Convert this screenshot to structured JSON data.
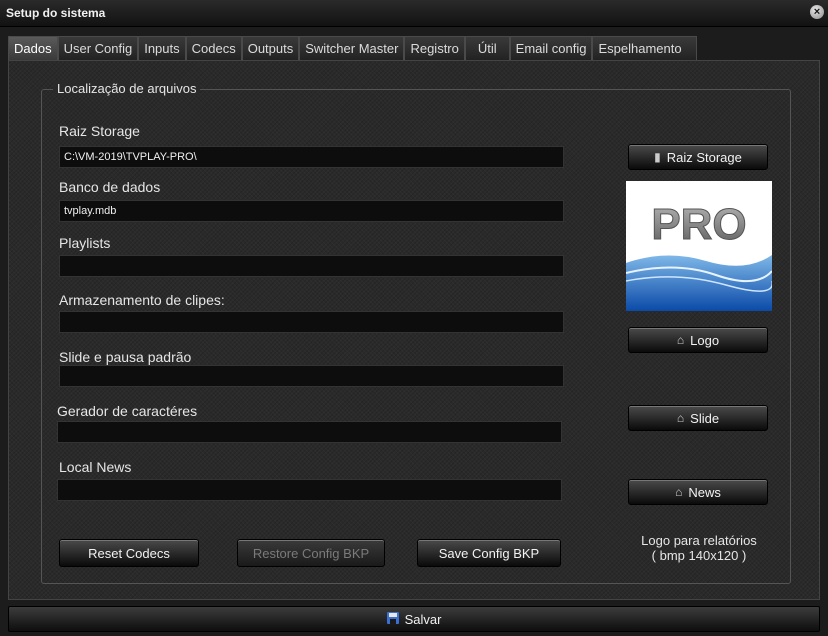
{
  "window": {
    "title": "Setup do sistema",
    "close_glyph": "×"
  },
  "tabs": [
    {
      "label": "Dados",
      "active": true
    },
    {
      "label": "User Config"
    },
    {
      "label": "Inputs"
    },
    {
      "label": "Codecs"
    },
    {
      "label": "Outputs"
    },
    {
      "label": "Switcher Master"
    },
    {
      "label": "Registro"
    },
    {
      "label": "Útil"
    },
    {
      "label": "Email config"
    },
    {
      "label": "Espelhamento"
    }
  ],
  "group": {
    "legend": "Localização de arquivos"
  },
  "fields": {
    "raiz_storage": {
      "label": "Raiz Storage",
      "value": "C:\\VM-2019\\TVPLAY-PRO\\"
    },
    "banco_dados": {
      "label": "Banco de dados",
      "value": "tvplay.mdb"
    },
    "playlists": {
      "label": "Playlists",
      "value": ""
    },
    "armazenamento": {
      "label": "Armazenamento de clipes:",
      "value": ""
    },
    "slide_pausa": {
      "label": "Slide e pausa padrão",
      "value": ""
    },
    "gerador": {
      "label": "Gerador de caractéres",
      "value": ""
    },
    "local_news": {
      "label": "Local  News",
      "value": ""
    }
  },
  "buttons": {
    "raiz_storage": "Raiz Storage",
    "logo": "Logo",
    "slide": "Slide",
    "news": "News",
    "reset_codecs": "Reset Codecs",
    "restore_config": "Restore Config BKP",
    "save_config": "Save Config BKP",
    "salvar": "Salvar"
  },
  "logo_image_text": "PRO",
  "logo_note": {
    "line1": "Logo para relatórios",
    "line2": "( bmp 140x120 )"
  },
  "icons": {
    "folder": "folder-icon",
    "camera": "camera-icon",
    "floppy": "floppy-icon"
  }
}
